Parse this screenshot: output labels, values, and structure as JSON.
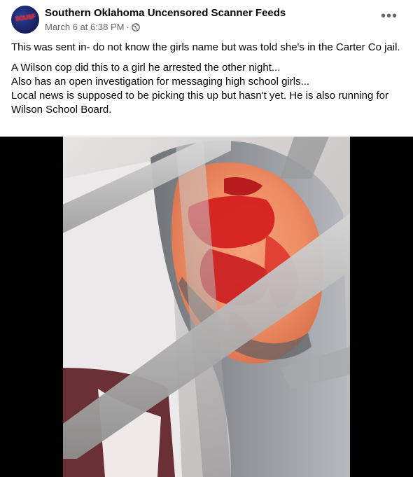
{
  "post": {
    "page_name": "Southern Oklahoma Uncensored Scanner Feeds",
    "avatar_text": "SOUSF",
    "timestamp": "March 6 at 6:38 PM",
    "separator": "·",
    "audience_icon": "globe-icon",
    "more_icon": "more-options-icon",
    "more_label": "•••",
    "message_paragraph_1": "This was sent in-  do not know the girls name but was told she's in the  Carter Co jail.",
    "message_lines": [
      "A Wilson cop did this to a girl he arrested the other night...",
      "Also has an open investigation for messaging high school girls...",
      "Local news is supposed to be picking this up but hasn't yet. He is also running for Wilson School Board."
    ],
    "media_description_icon": "photo"
  },
  "colors": {
    "text_primary": "#050505",
    "text_secondary": "#65676b",
    "media_background": "#000000"
  }
}
